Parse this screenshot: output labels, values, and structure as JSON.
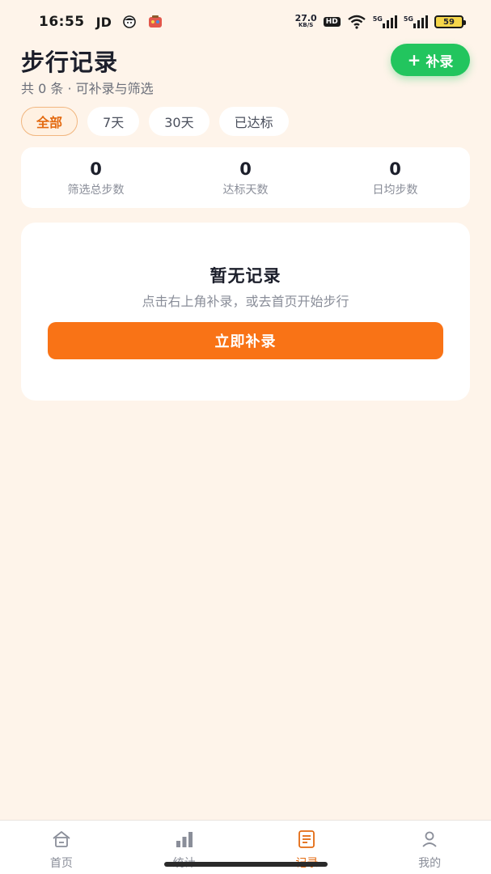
{
  "status_bar": {
    "time": "16:55",
    "carrier": "JD",
    "net_speed_value": "27.0",
    "net_speed_unit": "KB/S",
    "hd_label": "HD",
    "signal_1_label": "5G",
    "signal_2_label": "5G",
    "battery_level": "59",
    "icons": [
      "face-icon",
      "game-icon",
      "wifi-icon",
      "signal-icon",
      "battery-icon"
    ]
  },
  "header": {
    "title": "步行记录",
    "subtitle": "共 0 条 · 可补录与筛选",
    "add_button_label": "补录",
    "add_button_icon": "plus-icon"
  },
  "filters": {
    "active_index": 0,
    "items": [
      {
        "label": "全部"
      },
      {
        "label": "7天"
      },
      {
        "label": "30天"
      },
      {
        "label": "已达标"
      }
    ]
  },
  "stats": [
    {
      "value": "0",
      "label": "筛选总步数"
    },
    {
      "value": "0",
      "label": "达标天数"
    },
    {
      "value": "0",
      "label": "日均步数"
    }
  ],
  "empty_state": {
    "title": "暂无记录",
    "description": "点击右上角补录，或去首页开始步行",
    "cta_label": "立即补录"
  },
  "bottom_nav": {
    "active_index": 2,
    "items": [
      {
        "label": "首页",
        "icon": "home-icon"
      },
      {
        "label": "统计",
        "icon": "bar-chart-icon"
      },
      {
        "label": "记录",
        "icon": "document-icon"
      },
      {
        "label": "我的",
        "icon": "user-icon"
      }
    ]
  },
  "colors": {
    "background": "#FEF4EA",
    "primary_green": "#22C55E",
    "primary_orange": "#F97316",
    "active_text": "#E36A10",
    "card": "#FFFFFF"
  }
}
